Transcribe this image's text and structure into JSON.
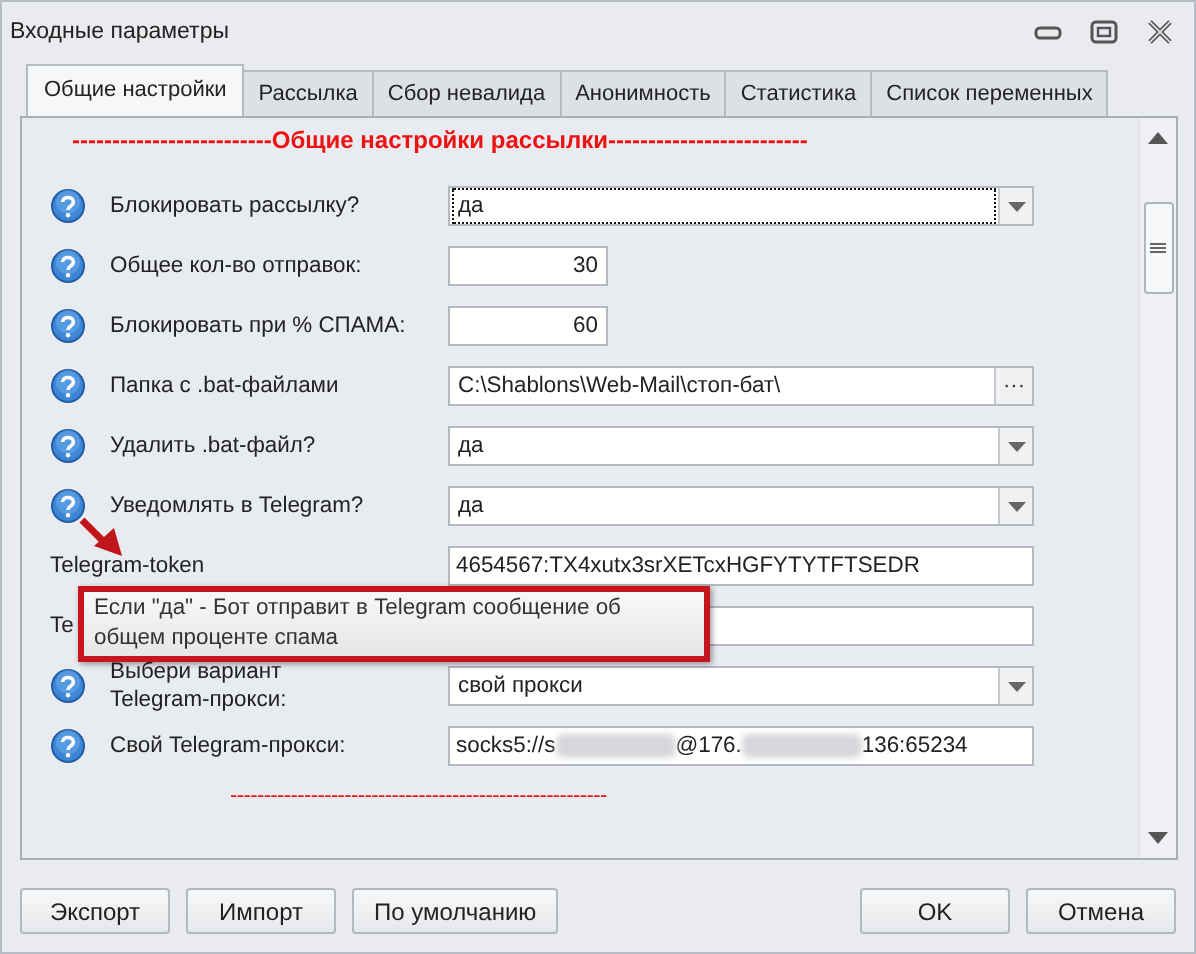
{
  "window": {
    "title": "Входные параметры"
  },
  "tabs": [
    {
      "label": "Общие настройки",
      "selected": true
    },
    {
      "label": "Рассылка",
      "selected": false
    },
    {
      "label": "Сбор невалида",
      "selected": false
    },
    {
      "label": "Анонимность",
      "selected": false
    },
    {
      "label": "Статистика",
      "selected": false
    },
    {
      "label": "Список переменных",
      "selected": false
    }
  ],
  "section_header": "-------------------------Общие настройки рассылки-------------------------",
  "settings": [
    {
      "kind": "combo",
      "help": true,
      "label": "Блокировать рассылку?",
      "value": "да",
      "focused": true
    },
    {
      "kind": "number",
      "help": true,
      "label": "Общее кол-во отправок:",
      "value": "30"
    },
    {
      "kind": "number",
      "help": true,
      "label": "Блокировать при % СПАМА:",
      "value": "60"
    },
    {
      "kind": "path",
      "help": true,
      "label": "Папка с .bat-файлами",
      "value": "C:\\Shablons\\Web-Mail\\стоп-бат\\",
      "button": "···"
    },
    {
      "kind": "combo",
      "help": true,
      "label": "Удалить .bat-файл?",
      "value": "да",
      "focused": false
    },
    {
      "kind": "combo",
      "help": true,
      "label": "Уведомлять в Telegram?",
      "value": "да",
      "focused": false
    },
    {
      "kind": "text",
      "help": false,
      "label": "Telegram-token",
      "value": "4654567:TX4xutx3srXETcxHGFYTYTFTSEDR"
    },
    {
      "kind": "text",
      "help": false,
      "label": "Te"
    },
    {
      "kind": "combo",
      "help": true,
      "label": "Выбери вариант\nTelegram-прокси:",
      "value": "свой прокси",
      "focused": false
    },
    {
      "kind": "masked",
      "help": true,
      "label": "Свой Telegram-прокси:",
      "parts": [
        {
          "kind": "text",
          "text": "socks5://s"
        },
        {
          "kind": "redacted"
        },
        {
          "kind": "text",
          "text": "@176."
        },
        {
          "kind": "redacted"
        },
        {
          "kind": "text",
          "text": "136:65234"
        }
      ]
    }
  ],
  "section_footer": "--------------------------------------------------------",
  "tooltip": {
    "text": "Если \"да\" - Бот отправит в Telegram сообщение об общем проценте спама"
  },
  "left_buttons": [
    {
      "label": "Экспорт"
    },
    {
      "label": "Импорт"
    },
    {
      "label": "По умолчанию"
    }
  ],
  "right_buttons": [
    {
      "label": "OK"
    },
    {
      "label": "Отмена"
    }
  ]
}
